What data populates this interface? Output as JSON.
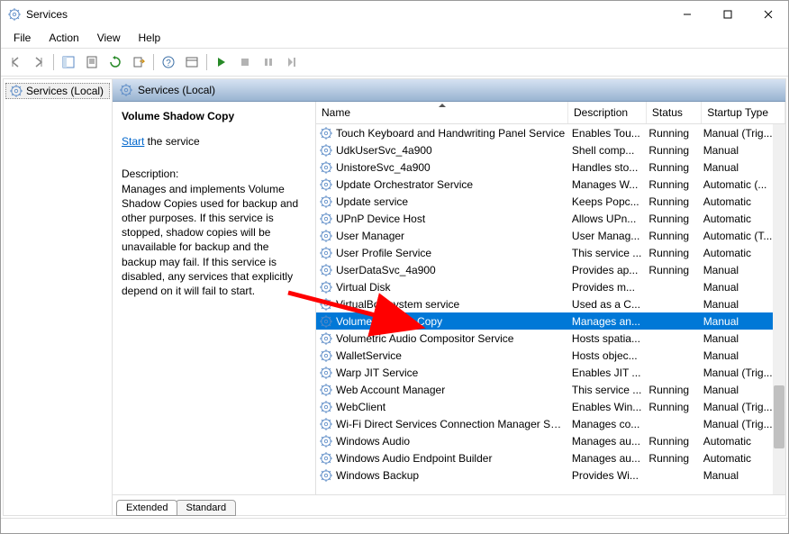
{
  "title": "Services",
  "menu": [
    "File",
    "Action",
    "View",
    "Help"
  ],
  "tree_root": "Services (Local)",
  "right_header": "Services (Local)",
  "detail": {
    "title": "Volume Shadow Copy",
    "action_link": "Start",
    "action_rest": " the service",
    "desc_label": "Description:",
    "desc_text": "Manages and implements Volume Shadow Copies used for backup and other purposes. If this service is stopped, shadow copies will be unavailable for backup and the backup may fail. If this service is disabled, any services that explicitly depend on it will fail to start."
  },
  "cols": {
    "name": "Name",
    "desc": "Description",
    "status": "Status",
    "startup": "Startup Type"
  },
  "tabs_extended": "Extended",
  "tabs_standard": "Standard",
  "rows": [
    {
      "n": "Touch Keyboard and Handwriting Panel Service",
      "d": "Enables Tou...",
      "s": "Running",
      "t": "Manual (Trig..."
    },
    {
      "n": "UdkUserSvc_4a900",
      "d": "Shell comp...",
      "s": "Running",
      "t": "Manual"
    },
    {
      "n": "UnistoreSvc_4a900",
      "d": "Handles sto...",
      "s": "Running",
      "t": "Manual"
    },
    {
      "n": "Update Orchestrator Service",
      "d": "Manages W...",
      "s": "Running",
      "t": "Automatic (..."
    },
    {
      "n": "Update service",
      "d": "Keeps Popc...",
      "s": "Running",
      "t": "Automatic"
    },
    {
      "n": "UPnP Device Host",
      "d": "Allows UPn...",
      "s": "Running",
      "t": "Automatic"
    },
    {
      "n": "User Manager",
      "d": "User Manag...",
      "s": "Running",
      "t": "Automatic (T..."
    },
    {
      "n": "User Profile Service",
      "d": "This service ...",
      "s": "Running",
      "t": "Automatic"
    },
    {
      "n": "UserDataSvc_4a900",
      "d": "Provides ap...",
      "s": "Running",
      "t": "Manual"
    },
    {
      "n": "Virtual Disk",
      "d": "Provides m...",
      "s": "",
      "t": "Manual"
    },
    {
      "n": "VirtualBox system service",
      "d": "Used as a C...",
      "s": "",
      "t": "Manual"
    },
    {
      "n": "Volume Shadow Copy",
      "d": "Manages an...",
      "s": "",
      "t": "Manual",
      "sel": true
    },
    {
      "n": "Volumetric Audio Compositor Service",
      "d": "Hosts spatia...",
      "s": "",
      "t": "Manual"
    },
    {
      "n": "WalletService",
      "d": "Hosts objec...",
      "s": "",
      "t": "Manual"
    },
    {
      "n": "Warp JIT Service",
      "d": "Enables JIT ...",
      "s": "",
      "t": "Manual (Trig..."
    },
    {
      "n": "Web Account Manager",
      "d": "This service ...",
      "s": "Running",
      "t": "Manual"
    },
    {
      "n": "WebClient",
      "d": "Enables Win...",
      "s": "Running",
      "t": "Manual (Trig..."
    },
    {
      "n": "Wi-Fi Direct Services Connection Manager Serv...",
      "d": "Manages co...",
      "s": "",
      "t": "Manual (Trig..."
    },
    {
      "n": "Windows Audio",
      "d": "Manages au...",
      "s": "Running",
      "t": "Automatic"
    },
    {
      "n": "Windows Audio Endpoint Builder",
      "d": "Manages au...",
      "s": "Running",
      "t": "Automatic"
    },
    {
      "n": "Windows Backup",
      "d": "Provides Wi...",
      "s": "",
      "t": "Manual"
    }
  ]
}
